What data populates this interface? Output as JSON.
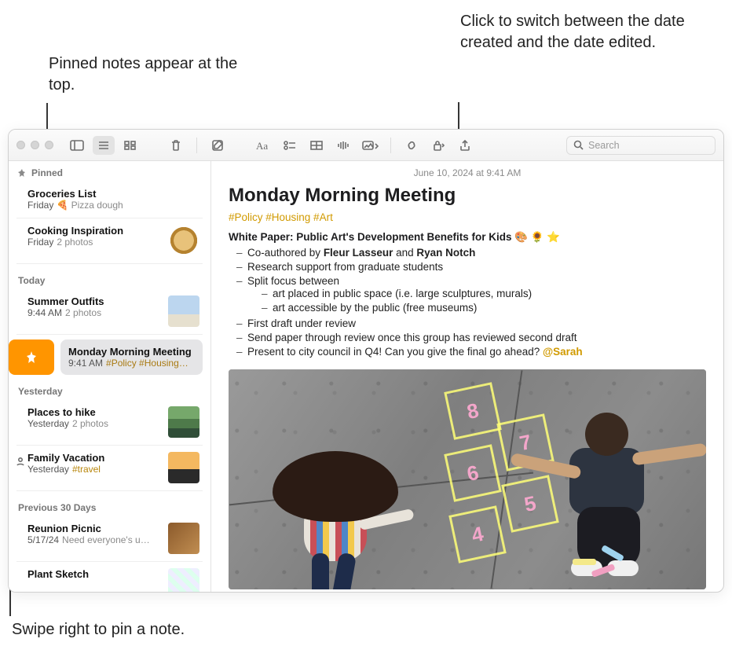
{
  "callouts": {
    "pinned_top": "Pinned notes appear at the top.",
    "date_toggle": "Click to switch between the date created and the date edited.",
    "swipe_pin": "Swipe right to pin a note."
  },
  "toolbar": {
    "search_placeholder": "Search"
  },
  "sections": {
    "pinned": "Pinned",
    "today": "Today",
    "yesterday": "Yesterday",
    "prev30": "Previous 30 Days"
  },
  "notes": {
    "groceries": {
      "title": "Groceries List",
      "time": "Friday",
      "preview": "🍕 Pizza dough"
    },
    "cooking": {
      "title": "Cooking Inspiration",
      "time": "Friday",
      "preview": "2 photos"
    },
    "outfits": {
      "title": "Summer Outfits",
      "time": "9:44 AM",
      "preview": "2 photos"
    },
    "meeting": {
      "title": "Monday Morning Meeting",
      "time": "9:41 AM",
      "preview": "#Policy #Housing…"
    },
    "hike": {
      "title": "Places to hike",
      "time": "Yesterday",
      "preview": "2 photos"
    },
    "vacation": {
      "title": "Family Vacation",
      "time": "Yesterday",
      "preview": "#travel"
    },
    "reunion": {
      "title": "Reunion Picnic",
      "time": "5/17/24",
      "preview": "Need everyone's u…"
    },
    "plant": {
      "title": "Plant Sketch",
      "time": "",
      "preview": ""
    }
  },
  "editor": {
    "date": "June 10, 2024 at 9:41 AM",
    "title": "Monday Morning Meeting",
    "hashtags": "#Policy #Housing #Art",
    "headline": "White Paper: Public Art's Development Benefits for Kids",
    "headline_emoji": "🎨 🌻 ⭐",
    "bullets": {
      "b1a": "Co-authored by ",
      "b1p1": "Fleur Lasseur",
      "b1mid": " and ",
      "b1p2": "Ryan Notch",
      "b2": "Research support from graduate students",
      "b3": "Split focus between",
      "b3a": "art placed in public space (i.e. large sculptures, murals)",
      "b3b": "art accessible by the public (free museums)",
      "b4": "First draft under review",
      "b5": "Send paper through review once this group has reviewed second draft",
      "b6a": "Present to city council in Q4! Can you give the final go ahead? ",
      "b6m": "@Sarah"
    }
  },
  "hopscotch": [
    "4",
    "5",
    "6",
    "7",
    "8"
  ]
}
